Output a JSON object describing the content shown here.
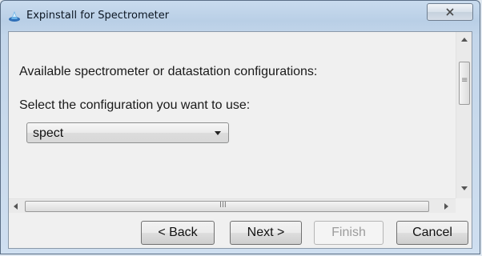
{
  "window": {
    "title": "Expinstall for Spectrometer"
  },
  "content": {
    "available_label": "Available spectrometer or datastation configurations:",
    "select_label": "Select the configuration you want to use:",
    "configuration_selected": "spect"
  },
  "scrollbar": {
    "h_grip": "III",
    "v_grip": "≡"
  },
  "buttons": {
    "back": "< Back",
    "next": "Next >",
    "finish": "Finish",
    "cancel": "Cancel"
  }
}
